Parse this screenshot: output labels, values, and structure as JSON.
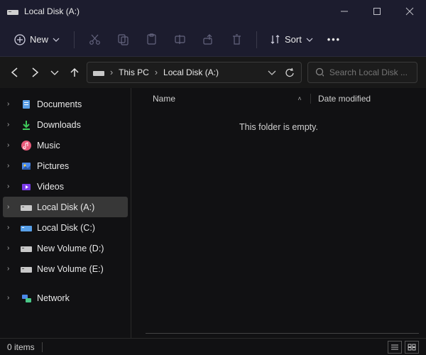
{
  "window": {
    "title": "Local Disk (A:)"
  },
  "toolbar": {
    "new_label": "New",
    "sort_label": "Sort"
  },
  "breadcrumb": {
    "root": "This PC",
    "current": "Local Disk (A:)"
  },
  "search": {
    "placeholder": "Search Local Disk ..."
  },
  "sidebar": {
    "items": [
      {
        "label": "Documents",
        "icon": "documents"
      },
      {
        "label": "Downloads",
        "icon": "downloads"
      },
      {
        "label": "Music",
        "icon": "music"
      },
      {
        "label": "Pictures",
        "icon": "pictures"
      },
      {
        "label": "Videos",
        "icon": "videos"
      },
      {
        "label": "Local Disk (A:)",
        "icon": "disk",
        "selected": true
      },
      {
        "label": "Local Disk (C:)",
        "icon": "disk-c"
      },
      {
        "label": "New Volume (D:)",
        "icon": "disk"
      },
      {
        "label": "New Volume (E:)",
        "icon": "disk"
      }
    ],
    "network_label": "Network"
  },
  "columns": {
    "name": "Name",
    "date": "Date modified"
  },
  "content": {
    "empty_message": "This folder is empty."
  },
  "status": {
    "count_text": "0 items"
  }
}
